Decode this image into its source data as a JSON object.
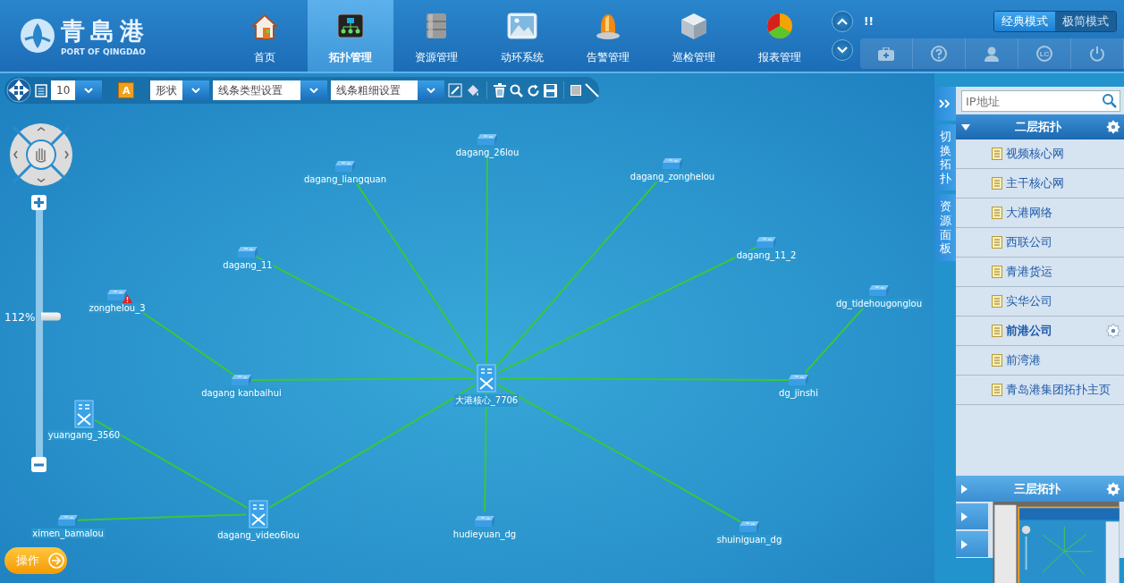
{
  "header": {
    "logo": {
      "name": "青島港",
      "subtitle": "PORT OF QINGDAO"
    },
    "nav": [
      {
        "label": "首页",
        "kind": "home",
        "selected": false
      },
      {
        "label": "拓扑管理",
        "kind": "topology",
        "selected": true
      },
      {
        "label": "资源管理",
        "kind": "database",
        "selected": false
      },
      {
        "label": "动环系统",
        "kind": "image",
        "selected": false
      },
      {
        "label": "告警管理",
        "kind": "alarm",
        "selected": false
      },
      {
        "label": "巡检管理",
        "kind": "cube",
        "selected": false
      },
      {
        "label": "报表管理",
        "kind": "pie",
        "selected": false
      }
    ],
    "notice": "!!",
    "modes": [
      {
        "label": "经典模式",
        "selected": true
      },
      {
        "label": "极简模式",
        "selected": false
      }
    ],
    "license_icon_text": "LC"
  },
  "toolbar": {
    "font_size": "10",
    "text_tool": "A",
    "shape": "形状",
    "line_type": "线条类型设置",
    "line_width": "线条粗细设置"
  },
  "navigator": {
    "zoom": "112%",
    "level": 0.57
  },
  "operate_button": "操作",
  "topology": {
    "nodes": [
      {
        "name": "大港核心_7706",
        "kind": "core",
        "alarm": false,
        "children": [
          {
            "name": "dagang_26lou",
            "kind": "switch",
            "alarm": false
          },
          {
            "name": "dagang_liangquan",
            "kind": "switch",
            "alarm": false
          },
          {
            "name": "dagang_zonghelou",
            "kind": "switch",
            "alarm": false
          },
          {
            "name": "dagang_11",
            "kind": "switch",
            "alarm": false
          },
          {
            "name": "dagang_11_2",
            "kind": "switch",
            "alarm": false
          },
          {
            "name": "dagang kanbaihui",
            "kind": "switch",
            "alarm": false,
            "children": [
              {
                "name": "zonghelou_3",
                "kind": "switch",
                "alarm": true
              }
            ]
          },
          {
            "name": "dg_jinshi",
            "kind": "switch",
            "alarm": false,
            "children": [
              {
                "name": "dg_tidehougonglou",
                "kind": "switch",
                "alarm": false
              }
            ]
          },
          {
            "name": "dagang_video6lou",
            "kind": "core",
            "alarm": false,
            "children": [
              {
                "name": "yuangang_3560",
                "kind": "core",
                "alarm": false
              },
              {
                "name": "ximen_bamalou",
                "kind": "switch",
                "alarm": false
              }
            ]
          },
          {
            "name": "hudieyuan_dg",
            "kind": "switch",
            "alarm": false
          },
          {
            "name": "shuiniguan_dg",
            "kind": "switch",
            "alarm": false
          }
        ]
      }
    ]
  },
  "side_tabs": [
    {
      "label": "切换拓扑"
    },
    {
      "label": "资源面板"
    }
  ],
  "panel": {
    "search": {
      "placeholder": "IP地址"
    },
    "groups": [
      {
        "title": "二层拓扑",
        "expanded": true,
        "items": [
          {
            "label": "视频核心网",
            "selected": false
          },
          {
            "label": "主干核心网",
            "selected": false
          },
          {
            "label": "大港网络",
            "selected": false
          },
          {
            "label": "西联公司",
            "selected": false
          },
          {
            "label": "青港货运",
            "selected": false
          },
          {
            "label": "实华公司",
            "selected": false
          },
          {
            "label": "前港公司",
            "selected": true
          },
          {
            "label": "前湾港",
            "selected": false
          },
          {
            "label": "青岛港集团拓扑主页",
            "selected": false
          }
        ]
      },
      {
        "title": "三层拓扑",
        "expanded": false
      },
      {
        "expanded": false
      },
      {
        "expanded": false
      }
    ]
  }
}
